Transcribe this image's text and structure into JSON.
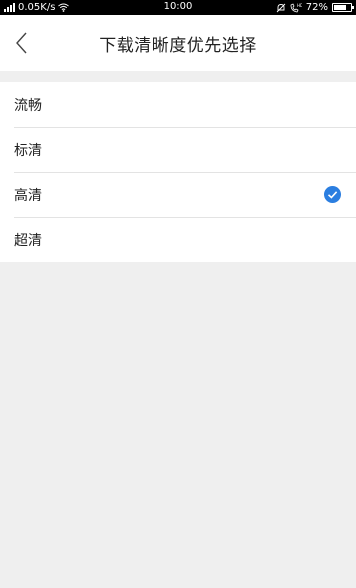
{
  "status_bar": {
    "left": "0.05K/s",
    "time": "10:00",
    "battery": "72%",
    "battery_level": 0.72
  },
  "header": {
    "title": "下载清晰度优先选择",
    "back_icon": "chevron-left-icon"
  },
  "options": [
    {
      "label": "流畅",
      "selected": false
    },
    {
      "label": "标清",
      "selected": false
    },
    {
      "label": "高清",
      "selected": true
    },
    {
      "label": "超清",
      "selected": false
    }
  ],
  "colors": {
    "accent": "#2b7ee0",
    "background": "#efefef"
  }
}
